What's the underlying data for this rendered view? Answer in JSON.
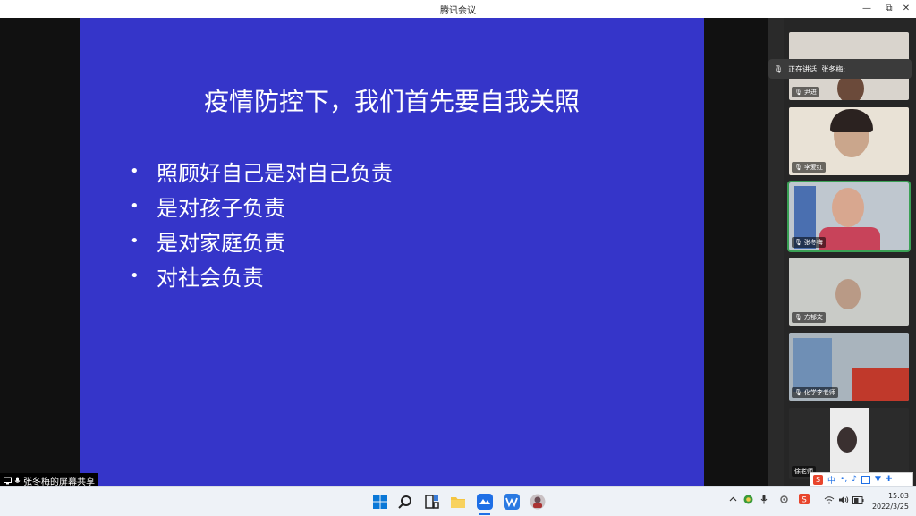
{
  "window": {
    "title": "腾讯会议",
    "minimize": "—",
    "restore": "⧉",
    "close": "✕"
  },
  "slide": {
    "title": "疫情防控下，我们首先要自我关照",
    "bullet_symbol": "•",
    "bullets": [
      "照顾好自己是对自己负责",
      "是对孩子负责",
      "是对家庭负责",
      "对社会负责"
    ],
    "background": "#3535c9"
  },
  "share": {
    "label": "张冬梅的屏幕共享"
  },
  "speaking": {
    "label": "正在讲话: 张冬梅;"
  },
  "participants": [
    {
      "name": "尹进"
    },
    {
      "name": "李爱红"
    },
    {
      "name": "张冬梅"
    },
    {
      "name": "方郁文"
    },
    {
      "name": "化学李老师"
    },
    {
      "name": "徐老师"
    }
  ],
  "tray": {
    "ime": "中",
    "date": "2022/3/25",
    "time": "15:03"
  }
}
